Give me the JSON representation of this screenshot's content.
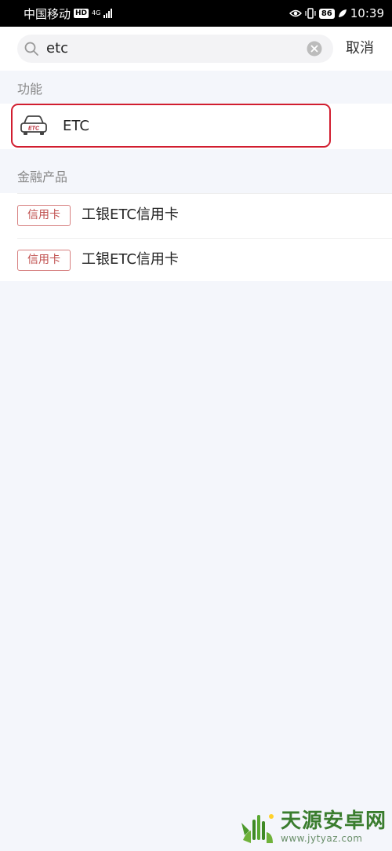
{
  "status_bar": {
    "carrier": "中国移动",
    "hd": "HD",
    "network": "4G",
    "battery": "86",
    "time": "10:39"
  },
  "search": {
    "query": "etc",
    "cancel_label": "取消"
  },
  "sections": {
    "function_title": "功能",
    "finance_title": "金融产品"
  },
  "function_items": [
    {
      "label": "ETC",
      "icon": "car-etc-icon"
    }
  ],
  "finance_items": [
    {
      "tag": "信用卡",
      "name": "工银ETC信用卡"
    },
    {
      "tag": "信用卡",
      "name": "工银ETC信用卡"
    }
  ],
  "watermark": {
    "title": "天源安卓网",
    "url": "www.jytyaz.com"
  },
  "colors": {
    "highlight_border": "#d11d2f",
    "tag_text": "#c0504f",
    "page_bg": "#f4f6fb"
  }
}
